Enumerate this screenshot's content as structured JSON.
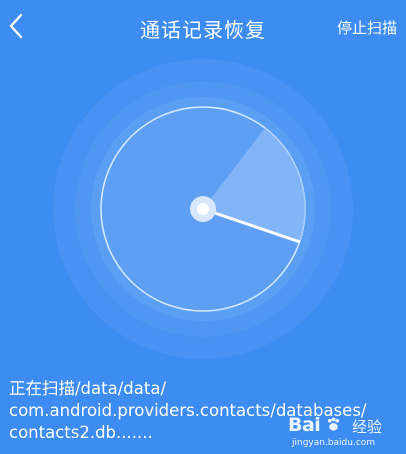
{
  "header": {
    "title": "通话记录恢复",
    "stop_label": "停止扫描"
  },
  "scan_status": {
    "line1": "正在扫描/data/data/",
    "line2": "com.android.providers.contacts/databases/",
    "line3": "contacts2.db......."
  },
  "watermark": {
    "brand": "Bai",
    "word": "经验",
    "url": "jingyan.baidu.com"
  },
  "colors": {
    "background": "#3d8cf1",
    "ring": "#5a9ff4",
    "sweep": "#8dbcf8",
    "text": "#ffffff"
  },
  "icons": {
    "back": "chevron-left-icon",
    "center": "radar-center-dot-icon",
    "watermark": "paw-icon"
  }
}
